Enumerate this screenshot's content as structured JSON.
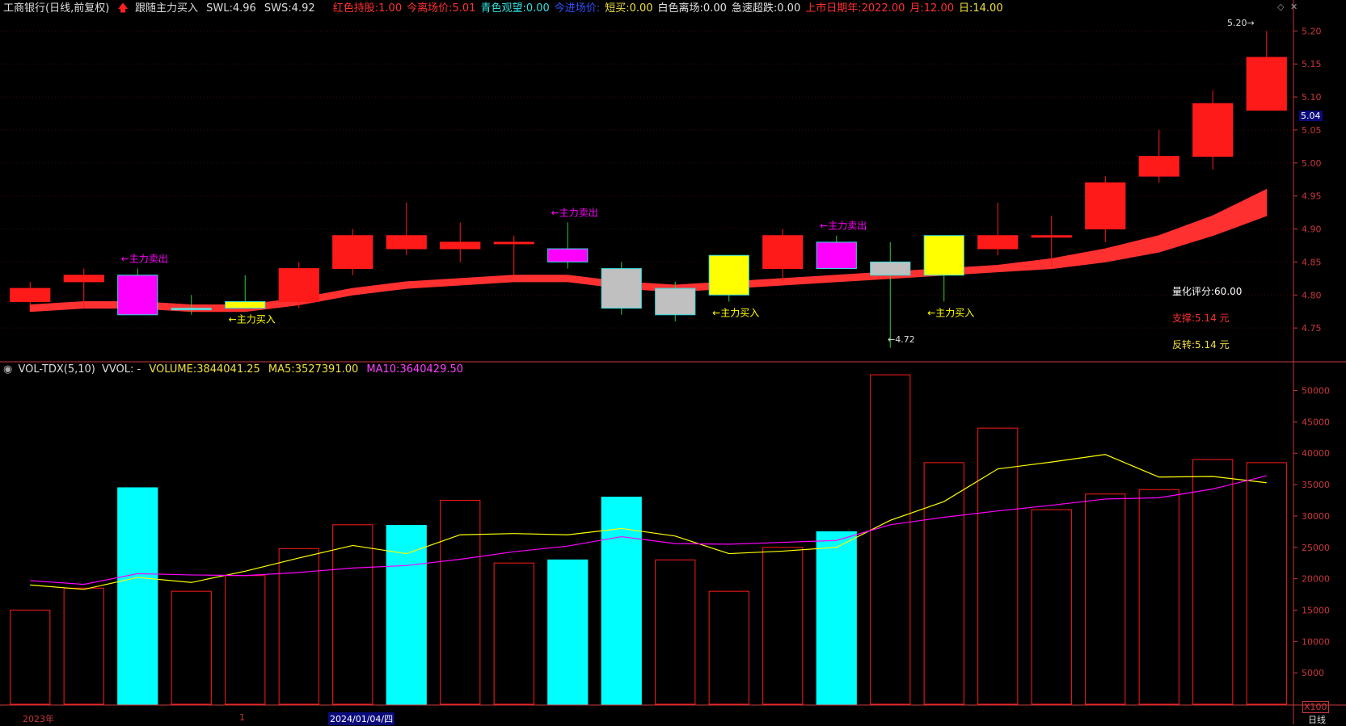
{
  "price_header": {
    "title": "工商银行(日线,前复权)",
    "arrow": "up-arrow-icon",
    "indicator": "跟随主力买入",
    "swl_label": "SWL:",
    "swl": "4.96",
    "sws_label": "SWS:",
    "sws": "4.92",
    "items": [
      {
        "label": "红色持股:",
        "value": "1.00",
        "color": "#ff3030"
      },
      {
        "label": "今离场价:",
        "value": "5.01",
        "color": "#ff3030"
      },
      {
        "label": "青色观望:",
        "value": "0.00",
        "color": "#33e0e0"
      },
      {
        "label": "今进场价:",
        "value": "",
        "color": "#3050ff"
      },
      {
        "label": "短买:",
        "value": "0.00",
        "color": "#f0e040"
      },
      {
        "label": "白色离场:",
        "value": "0.00",
        "color": "#e0e0e0"
      },
      {
        "label": "急速超跌:",
        "value": "0.00",
        "color": "#e0e0e0"
      },
      {
        "label": "上市日期年:",
        "value": "2022.00",
        "color": "#ff3030"
      },
      {
        "label": "月:",
        "value": "12.00",
        "color": "#ff3030"
      },
      {
        "label": "日:",
        "value": "14.00",
        "color": "#f0e040"
      }
    ]
  },
  "vol_header": {
    "name": "VOL-TDX(5,10)",
    "vvol": "VVOL: -",
    "volume_label": "VOLUME:",
    "volume": "3844041.25",
    "ma5_label": "MA5:",
    "ma5": "3527391.00",
    "ma10_label": "MA10:",
    "ma10": "3640429.50"
  },
  "right_info": {
    "score": "量化评分:60.00",
    "support": "支撑:5.14 元",
    "reversal": "反转:5.14 元"
  },
  "current_price": "5.04",
  "high_marker": "5.20",
  "low_marker": "←4.72",
  "unit_label": "X100",
  "period_label": "日线",
  "date_labels": {
    "year": "2023年",
    "month": "1",
    "date": "2024/01/04/四"
  },
  "colors": {
    "up": "#ff1a1a",
    "axis": "#c8383b",
    "grid": "#3a0a0a",
    "cyan": "#00ffff",
    "magenta": "#ff00ff",
    "yellow": "#ffff00",
    "gray": "#c0c0c0"
  },
  "chart_data": [
    {
      "type": "candlestick",
      "title": "工商银行(日线,前复权)",
      "ylim": [
        4.7,
        5.22
      ],
      "yticks": [
        4.75,
        4.8,
        4.85,
        4.9,
        4.95,
        5.0,
        5.05,
        5.1,
        5.15,
        5.2
      ],
      "candles": [
        {
          "o": 4.79,
          "c": 4.81,
          "h": 4.82,
          "l": 4.78,
          "color": "red"
        },
        {
          "o": 4.82,
          "c": 4.83,
          "h": 4.84,
          "l": 4.78,
          "color": "red"
        },
        {
          "o": 4.77,
          "c": 4.83,
          "h": 4.84,
          "l": 4.77,
          "color": "magenta",
          "signal": "←主力卖出"
        },
        {
          "o": 4.78,
          "c": 4.78,
          "h": 4.8,
          "l": 4.77,
          "color": "gray"
        },
        {
          "o": 4.78,
          "c": 4.79,
          "h": 4.83,
          "l": 4.78,
          "color": "yellow",
          "signal": "←主力买入"
        },
        {
          "o": 4.79,
          "c": 4.84,
          "h": 4.85,
          "l": 4.78,
          "color": "red"
        },
        {
          "o": 4.84,
          "c": 4.89,
          "h": 4.9,
          "l": 4.83,
          "color": "red"
        },
        {
          "o": 4.87,
          "c": 4.89,
          "h": 4.94,
          "l": 4.86,
          "color": "red"
        },
        {
          "o": 4.87,
          "c": 4.88,
          "h": 4.91,
          "l": 4.85,
          "color": "red"
        },
        {
          "o": 4.88,
          "c": 4.88,
          "h": 4.89,
          "l": 4.83,
          "color": "red"
        },
        {
          "o": 4.85,
          "c": 4.87,
          "h": 4.91,
          "l": 4.84,
          "color": "magenta",
          "signal": "←主力卖出"
        },
        {
          "o": 4.84,
          "c": 4.78,
          "h": 4.85,
          "l": 4.77,
          "color": "gray"
        },
        {
          "o": 4.81,
          "c": 4.77,
          "h": 4.82,
          "l": 4.76,
          "color": "gray"
        },
        {
          "o": 4.8,
          "c": 4.86,
          "h": 4.86,
          "l": 4.79,
          "color": "yellow",
          "signal": "←主力买入"
        },
        {
          "o": 4.84,
          "c": 4.89,
          "h": 4.9,
          "l": 4.82,
          "color": "red"
        },
        {
          "o": 4.84,
          "c": 4.88,
          "h": 4.89,
          "l": 4.84,
          "color": "magenta",
          "signal": "←主力卖出"
        },
        {
          "o": 4.85,
          "c": 4.83,
          "h": 4.88,
          "l": 4.72,
          "color": "gray"
        },
        {
          "o": 4.83,
          "c": 4.89,
          "h": 4.89,
          "l": 4.79,
          "color": "yellow",
          "signal": "←主力买入"
        },
        {
          "o": 4.87,
          "c": 4.89,
          "h": 4.94,
          "l": 4.86,
          "color": "red"
        },
        {
          "o": 4.89,
          "c": 4.89,
          "h": 4.92,
          "l": 4.84,
          "color": "red"
        },
        {
          "o": 4.9,
          "c": 4.97,
          "h": 4.98,
          "l": 4.88,
          "color": "red"
        },
        {
          "o": 4.98,
          "c": 5.01,
          "h": 5.05,
          "l": 4.97,
          "color": "red"
        },
        {
          "o": 5.01,
          "c": 5.09,
          "h": 5.11,
          "l": 4.99,
          "color": "red"
        },
        {
          "o": 5.08,
          "c": 5.16,
          "h": 5.2,
          "l": 5.08,
          "color": "red"
        }
      ],
      "band_upper": [
        4.785,
        4.79,
        4.79,
        4.785,
        4.785,
        4.795,
        4.81,
        4.82,
        4.825,
        4.83,
        4.83,
        4.82,
        4.815,
        4.82,
        4.825,
        4.83,
        4.835,
        4.84,
        4.845,
        4.855,
        4.87,
        4.89,
        4.92,
        4.96
      ],
      "band_lower": [
        4.775,
        4.78,
        4.78,
        4.775,
        4.775,
        4.785,
        4.8,
        4.81,
        4.815,
        4.82,
        4.82,
        4.81,
        4.805,
        4.81,
        4.815,
        4.82,
        4.825,
        4.83,
        4.835,
        4.84,
        4.85,
        4.865,
        4.89,
        4.92
      ]
    },
    {
      "type": "bar",
      "title": "VOL-TDX(5,10)",
      "unit": "X100",
      "ylim": [
        0,
        52000
      ],
      "yticks": [
        5000,
        10000,
        15000,
        20000,
        25000,
        30000,
        35000,
        40000,
        45000,
        50000
      ],
      "series": [
        {
          "name": "VOLUME",
          "values": [
            15000,
            18500,
            34500,
            18000,
            20500,
            24800,
            28600,
            28500,
            32500,
            22500,
            23000,
            33000,
            23000,
            18000,
            25000,
            27500,
            52500,
            38500,
            44000,
            31000,
            33500,
            34200,
            39000,
            38500
          ],
          "colors": [
            "red",
            "red",
            "cyan",
            "red",
            "red",
            "red",
            "red",
            "cyan",
            "red",
            "red",
            "cyan",
            "cyan",
            "red",
            "red",
            "red",
            "cyan",
            "red",
            "red",
            "red",
            "red",
            "red",
            "red",
            "red",
            "red"
          ]
        },
        {
          "name": "MA5",
          "values": [
            19000,
            18300,
            20200,
            19400,
            21200,
            23300,
            25300,
            24000,
            27000,
            27200,
            27000,
            28000,
            26800,
            24000,
            24400,
            25000,
            29300,
            32300,
            37500,
            38600,
            39800,
            36200,
            36300,
            35300
          ]
        },
        {
          "name": "MA10",
          "values": [
            19700,
            19100,
            20800,
            20600,
            20500,
            21000,
            21700,
            22100,
            23100,
            24300,
            25200,
            26700,
            25600,
            25500,
            25800,
            26100,
            28600,
            29800,
            30800,
            31700,
            32700,
            32900,
            34300,
            36400
          ]
        }
      ]
    }
  ]
}
